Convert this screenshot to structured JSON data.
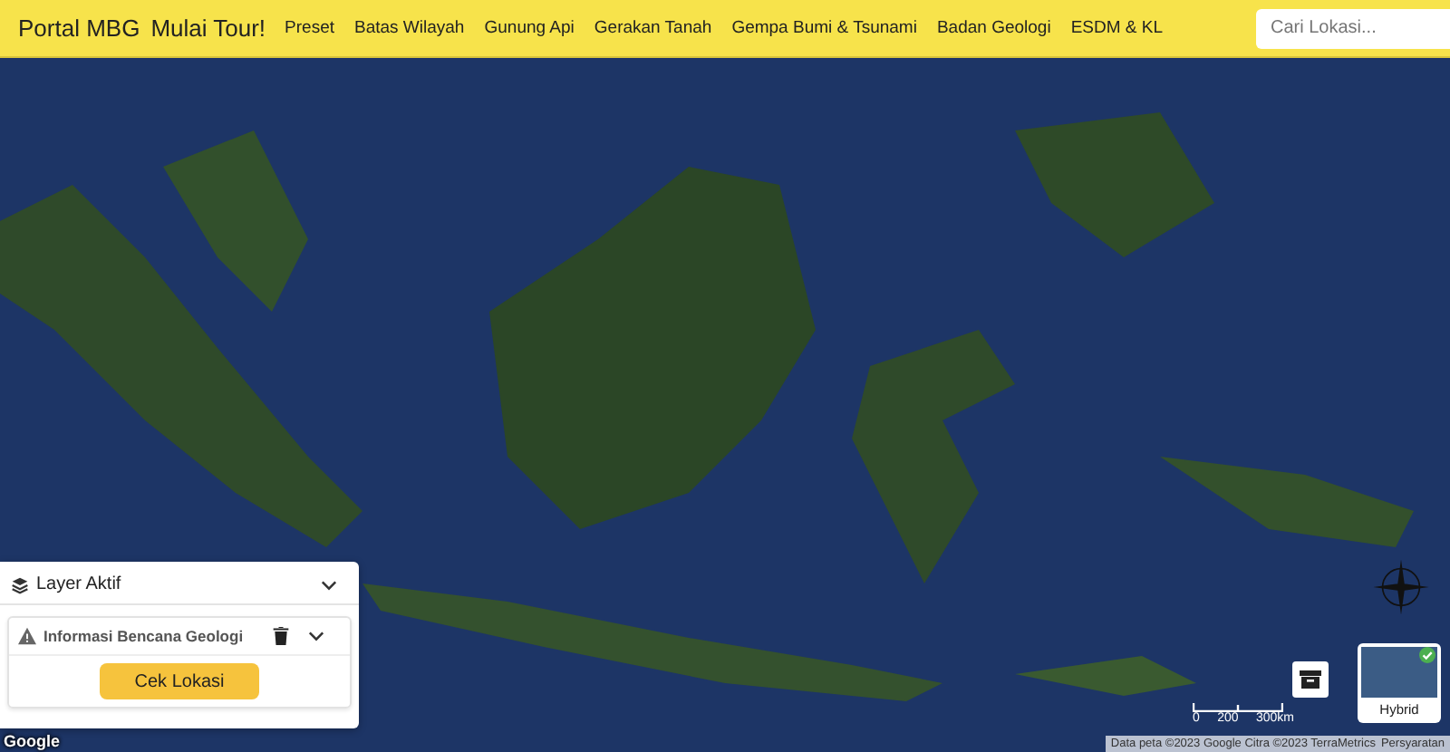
{
  "header": {
    "brand": "Portal MBG",
    "tour": "Mulai Tour!",
    "nav": [
      "Preset",
      "Batas Wilayah",
      "Gunung Api",
      "Gerakan Tanah",
      "Gempa Bumi & Tsunami",
      "Badan Geologi",
      "ESDM & KL"
    ],
    "search": {
      "placeholder": "Cari Lokasi..."
    }
  },
  "layer_panel": {
    "title": "Layer Aktif",
    "expanded": true,
    "layers": [
      {
        "title": "Informasi Bencana Geologi",
        "button": "Cek Lokasi"
      }
    ]
  },
  "map": {
    "logo": "Google",
    "layer_toggle": {
      "label": "Hybrid",
      "checked": true
    },
    "scale": {
      "ticks": [
        "0",
        "200",
        "300km"
      ]
    },
    "attribution": "Data peta ©2023 Google Citra ©2023 TerraMetrics",
    "terms": "Persyaratan"
  }
}
